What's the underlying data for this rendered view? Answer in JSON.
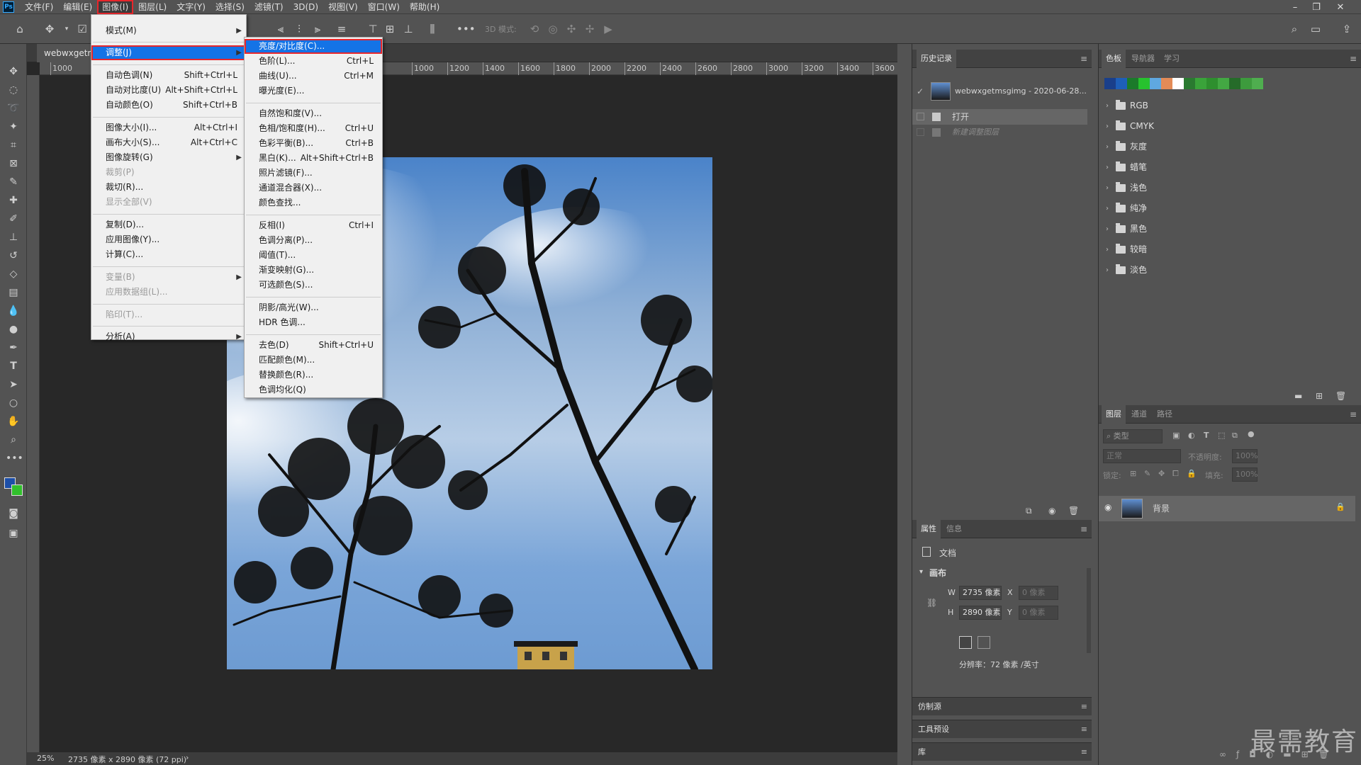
{
  "menubar": {
    "logo": "Ps",
    "items": [
      "文件(F)",
      "编辑(E)",
      "图像(I)",
      "图层(L)",
      "文字(Y)",
      "选择(S)",
      "滤镜(T)",
      "3D(D)",
      "视图(V)",
      "窗口(W)",
      "帮助(H)"
    ],
    "active_index": 2
  },
  "window_controls": {
    "minimize": "–",
    "restore": "❐",
    "close": "✕"
  },
  "optbar": {
    "mode_label": "3D 模式:"
  },
  "document": {
    "tab_title": "webwxgetmsg",
    "ruler_h": [
      "1000",
      "1200",
      "1400",
      "1600",
      "1800",
      "2000",
      "2200",
      "2400",
      "2600",
      "2800",
      "3000",
      "3200",
      "3400",
      "3600"
    ],
    "ruler_h_left": "1000",
    "zoom": "25%",
    "info": "2735 像素 x 2890 像素 (72 ppi)"
  },
  "image_menu": {
    "rows": [
      {
        "label": "模式(M)",
        "shortcut": "",
        "submenu": true,
        "disabled": false
      },
      {
        "label": "调整(J)",
        "shortcut": "",
        "submenu": true,
        "disabled": false,
        "highlighted": true
      },
      {
        "label": "自动色调(N)",
        "shortcut": "Shift+Ctrl+L",
        "disabled": false
      },
      {
        "label": "自动对比度(U)",
        "shortcut": "Alt+Shift+Ctrl+L",
        "disabled": false
      },
      {
        "label": "自动颜色(O)",
        "shortcut": "Shift+Ctrl+B",
        "disabled": false
      },
      {
        "label": "图像大小(I)...",
        "shortcut": "Alt+Ctrl+I",
        "disabled": false
      },
      {
        "label": "画布大小(S)...",
        "shortcut": "Alt+Ctrl+C",
        "disabled": false
      },
      {
        "label": "图像旋转(G)",
        "shortcut": "",
        "submenu": true,
        "disabled": false
      },
      {
        "label": "裁剪(P)",
        "shortcut": "",
        "disabled": true
      },
      {
        "label": "裁切(R)...",
        "shortcut": "",
        "disabled": false
      },
      {
        "label": "显示全部(V)",
        "shortcut": "",
        "disabled": true
      },
      {
        "label": "复制(D)...",
        "shortcut": "",
        "disabled": false
      },
      {
        "label": "应用图像(Y)...",
        "shortcut": "",
        "disabled": false
      },
      {
        "label": "计算(C)...",
        "shortcut": "",
        "disabled": false
      },
      {
        "label": "变量(B)",
        "shortcut": "",
        "submenu": true,
        "disabled": true
      },
      {
        "label": "应用数据组(L)...",
        "shortcut": "",
        "disabled": true
      },
      {
        "label": "陷印(T)...",
        "shortcut": "",
        "disabled": true
      },
      {
        "label": "分析(A)",
        "shortcut": "",
        "submenu": true,
        "disabled": false
      }
    ]
  },
  "adjust_menu": {
    "rows": [
      {
        "label": "亮度/对比度(C)...",
        "shortcut": "",
        "highlighted": true
      },
      {
        "label": "色阶(L)...",
        "shortcut": "Ctrl+L"
      },
      {
        "label": "曲线(U)...",
        "shortcut": "Ctrl+M"
      },
      {
        "label": "曝光度(E)...",
        "shortcut": ""
      },
      {
        "label": "自然饱和度(V)...",
        "shortcut": ""
      },
      {
        "label": "色相/饱和度(H)...",
        "shortcut": "Ctrl+U"
      },
      {
        "label": "色彩平衡(B)...",
        "shortcut": "Ctrl+B"
      },
      {
        "label": "黑白(K)...",
        "shortcut": "Alt+Shift+Ctrl+B"
      },
      {
        "label": "照片滤镜(F)...",
        "shortcut": ""
      },
      {
        "label": "通道混合器(X)...",
        "shortcut": ""
      },
      {
        "label": "颜色查找...",
        "shortcut": ""
      },
      {
        "label": "反相(I)",
        "shortcut": "Ctrl+I"
      },
      {
        "label": "色调分离(P)...",
        "shortcut": ""
      },
      {
        "label": "阈值(T)...",
        "shortcut": ""
      },
      {
        "label": "渐变映射(G)...",
        "shortcut": ""
      },
      {
        "label": "可选颜色(S)...",
        "shortcut": ""
      },
      {
        "label": "阴影/高光(W)...",
        "shortcut": ""
      },
      {
        "label": "HDR 色调...",
        "shortcut": ""
      },
      {
        "label": "去色(D)",
        "shortcut": "Shift+Ctrl+U"
      },
      {
        "label": "匹配颜色(M)...",
        "shortcut": ""
      },
      {
        "label": "替换颜色(R)...",
        "shortcut": ""
      },
      {
        "label": "色调均化(Q)",
        "shortcut": ""
      }
    ]
  },
  "history": {
    "tab": "历史记录",
    "snapshot": "webwxgetmsgimg - 2020-06-28...",
    "items": [
      "打开",
      "新建调整图层"
    ]
  },
  "properties": {
    "tabs": [
      "属性",
      "信息"
    ],
    "doc_label": "文档",
    "canvas_label": "画布",
    "w_label": "W",
    "h_label": "H",
    "x_label": "X",
    "y_label": "Y",
    "w_value": "2735 像素",
    "h_value": "2890 像素",
    "x_value": "0 像素",
    "y_value": "0 像素",
    "resolution": "分辨率：72 像素 /英寸"
  },
  "collapsed_panels": [
    "仿制源",
    "工具预设",
    "库"
  ],
  "swatches": {
    "tabs": [
      "色板",
      "导航器",
      "学习"
    ],
    "colors": [
      "#1a3f8a",
      "#1e5fb8",
      "#1b7a2a",
      "#27c22e",
      "#5fa8e0",
      "#e38b57",
      "#ffffff",
      "#2a7a30",
      "#3aa33a",
      "#2e8f2e",
      "#43a843",
      "#256b29",
      "#3d9b3d",
      "#4fae4f"
    ],
    "groups": [
      "RGB",
      "CMYK",
      "灰度",
      "蜡笔",
      "浅色",
      "纯净",
      "黑色",
      "较暗",
      "淡色"
    ]
  },
  "layers": {
    "tabs": [
      "图层",
      "通道",
      "路径"
    ],
    "search_placeholder": "类型",
    "blend_mode": "正常",
    "opacity_label": "不透明度:",
    "opacity_value": "100%",
    "lock_label": "锁定:",
    "fill_label": "填充:",
    "fill_value": "100%",
    "layer_name": "背景"
  },
  "watermark": "最需教育"
}
